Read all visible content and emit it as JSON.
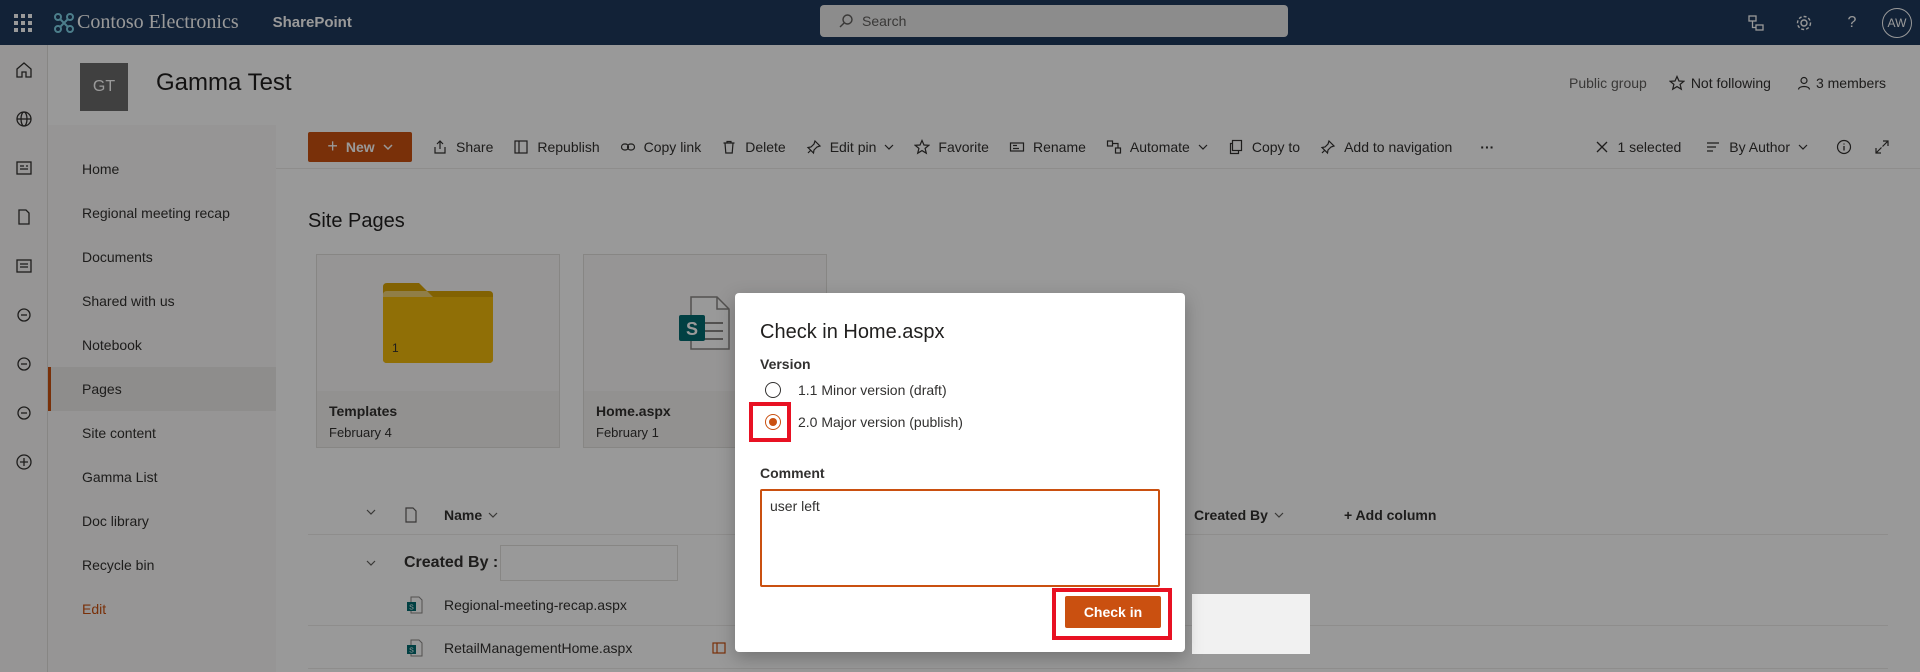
{
  "suite": {
    "brand": "Contoso Electronics",
    "app": "SharePoint",
    "search_placeholder": "Search",
    "avatar": "AW",
    "help": "?"
  },
  "site": {
    "logo": "GT",
    "title": "Gamma Test",
    "group_type": "Public group",
    "follow": "Not following",
    "members": "3 members"
  },
  "nav": {
    "items": [
      {
        "label": "Home"
      },
      {
        "label": "Regional meeting recap"
      },
      {
        "label": "Documents"
      },
      {
        "label": "Shared with us"
      },
      {
        "label": "Notebook"
      },
      {
        "label": "Pages"
      },
      {
        "label": "Site content"
      },
      {
        "label": "Gamma List"
      },
      {
        "label": "Doc library"
      },
      {
        "label": "Recycle bin"
      }
    ],
    "edit": "Edit",
    "selected": "Pages"
  },
  "commands": {
    "new": "New",
    "share": "Share",
    "republish": "Republish",
    "copy_link": "Copy link",
    "delete": "Delete",
    "edit_pin": "Edit pin",
    "favorite": "Favorite",
    "rename": "Rename",
    "automate": "Automate",
    "copy_to": "Copy to",
    "add_to_nav": "Add to navigation",
    "more": "···",
    "selected": "1 selected",
    "group_by": "By Author"
  },
  "content": {
    "section_title": "Site Pages",
    "tiles": [
      {
        "name": "Templates",
        "date": "February 4",
        "count": "1"
      },
      {
        "name": "Home.aspx",
        "date": "February 1"
      }
    ],
    "columns": {
      "name": "Name",
      "created_by": "Created By",
      "add_column": "+ Add column"
    },
    "group_label": "Created By :",
    "files": [
      {
        "name": "Regional-meeting-recap.aspx"
      },
      {
        "name": "RetailManagementHome.aspx"
      }
    ]
  },
  "dialog": {
    "title": "Check in Home.aspx",
    "version_label": "Version",
    "options": [
      {
        "label": "1.1 Minor version (draft)",
        "checked": false
      },
      {
        "label": "2.0 Major version (publish)",
        "checked": true
      }
    ],
    "comment_label": "Comment",
    "comment_value": "user left",
    "checkin_button": "Check in"
  },
  "colors": {
    "accent": "#ca5010",
    "suitebar": "#1f3a5c",
    "highlight": "#e81123"
  }
}
